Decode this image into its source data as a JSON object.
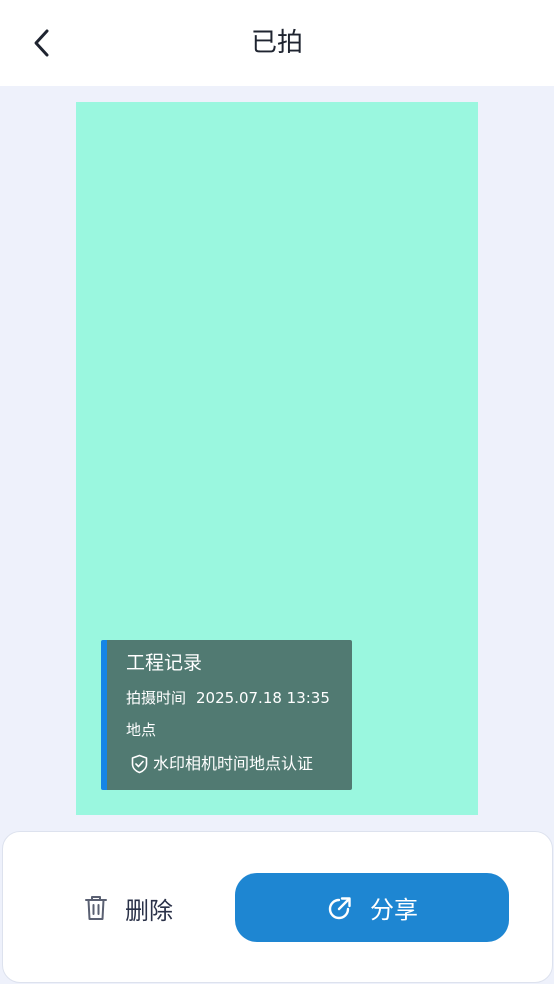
{
  "header": {
    "title": "已拍",
    "back_icon": "chevron-left-icon"
  },
  "photo": {
    "background_color": "#9af7df",
    "watermark": {
      "title": "工程记录",
      "time_label": "拍摄时间",
      "time_value": "2025.07.18 13:35",
      "location_label": "地点",
      "certification_text": "水印相机时间地点认证",
      "certification_icon": "shield-check-icon",
      "accent_color": "#1585e6",
      "background_color": "#517a72"
    }
  },
  "actions": {
    "delete_label": "删除",
    "delete_icon": "trash-icon",
    "share_label": "分享",
    "share_icon": "share-icon",
    "share_color": "#1e86d2"
  }
}
